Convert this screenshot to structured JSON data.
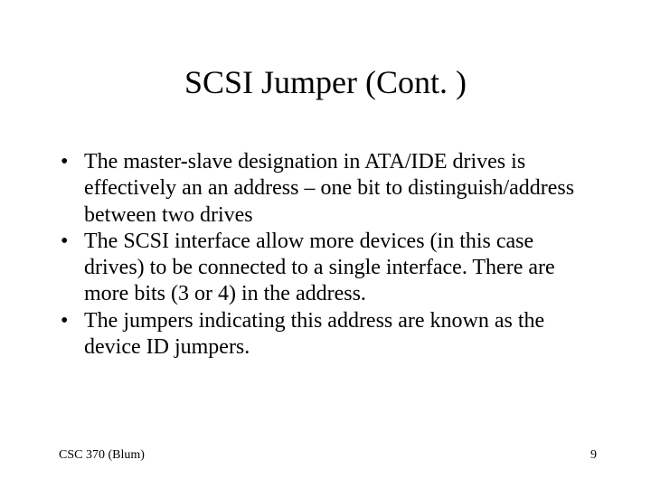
{
  "slide": {
    "title": "SCSI Jumper (Cont. )",
    "bullets": [
      "The master-slave designation in ATA/IDE drives is effectively an an address – one bit to distinguish/address between two drives",
      "The SCSI interface allow more devices (in this case drives) to be connected to a single interface. There are more bits (3 or 4) in the address.",
      "The jumpers indicating this address are known as the device ID jumpers."
    ],
    "footer_left": "CSC 370 (Blum)",
    "footer_right": "9"
  }
}
